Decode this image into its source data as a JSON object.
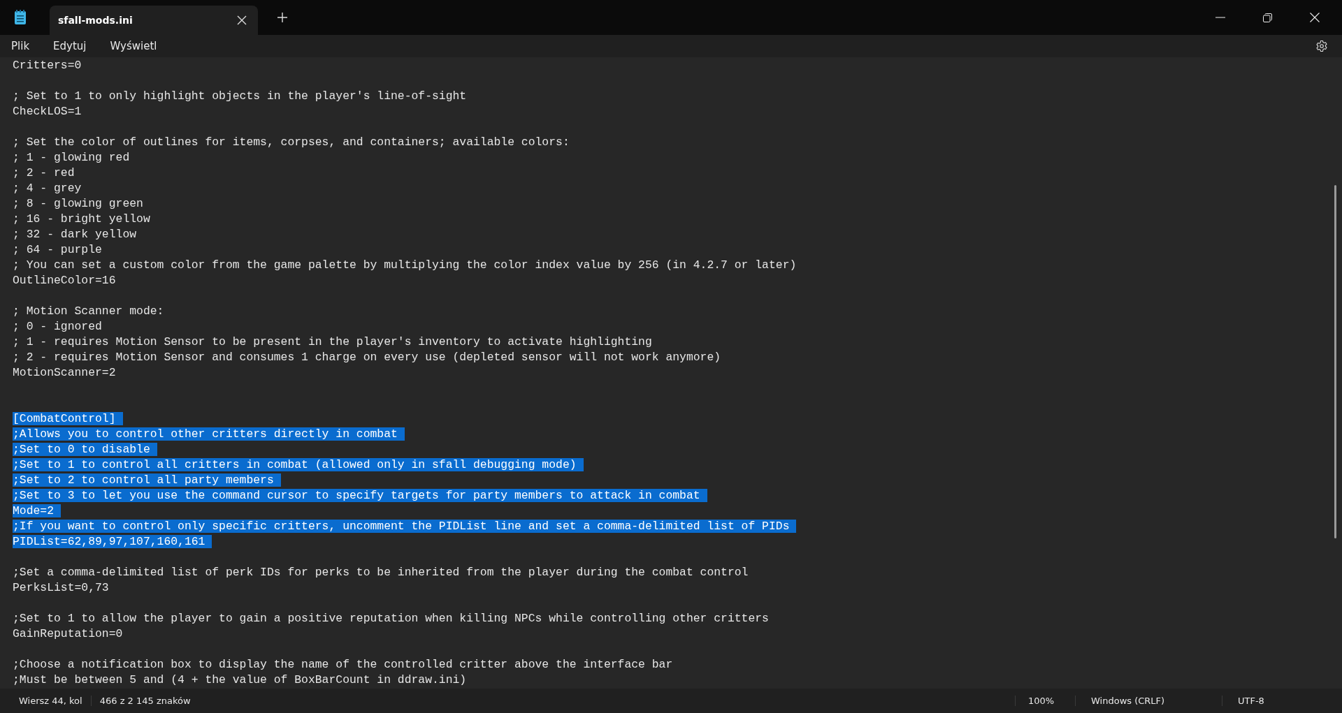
{
  "tab": {
    "title": "sfall-mods.ini",
    "selected": true
  },
  "menu": [
    "Plik",
    "Edytuj",
    "Wyświetl"
  ],
  "lines": [
    {
      "kind": "text",
      "text": "Critters=0",
      "selected": false
    },
    {
      "kind": "blank"
    },
    {
      "kind": "text",
      "text": "; Set to 1 to only highlight objects in the player's line-of-sight",
      "selected": false
    },
    {
      "kind": "text",
      "text": "CheckLOS=1",
      "selected": false
    },
    {
      "kind": "blank"
    },
    {
      "kind": "text",
      "text": "; Set the color of outlines for items, corpses, and containers; available colors:",
      "selected": false
    },
    {
      "kind": "text",
      "text": "; 1 - glowing red",
      "selected": false
    },
    {
      "kind": "text",
      "text": "; 2 - red",
      "selected": false
    },
    {
      "kind": "text",
      "text": "; 4 - grey",
      "selected": false
    },
    {
      "kind": "text",
      "text": "; 8 - glowing green",
      "selected": false
    },
    {
      "kind": "text",
      "text": "; 16 - bright yellow",
      "selected": false
    },
    {
      "kind": "text",
      "text": "; 32 - dark yellow",
      "selected": false
    },
    {
      "kind": "text",
      "text": "; 64 - purple",
      "selected": false
    },
    {
      "kind": "text",
      "text": "; You can set a custom color from the game palette by multiplying the color index value by 256 (in 4.2.7 or later)",
      "selected": false
    },
    {
      "kind": "text",
      "text": "OutlineColor=16",
      "selected": false
    },
    {
      "kind": "blank"
    },
    {
      "kind": "text",
      "text": "; Motion Scanner mode:",
      "selected": false
    },
    {
      "kind": "text",
      "text": "; 0 - ignored",
      "selected": false
    },
    {
      "kind": "text",
      "text": "; 1 - requires Motion Sensor to be present in the player's inventory to activate highlighting",
      "selected": false
    },
    {
      "kind": "text",
      "text": "; 2 - requires Motion Sensor and consumes 1 charge on every use (depleted sensor will not work anymore)",
      "selected": false
    },
    {
      "kind": "text",
      "text": "MotionScanner=2",
      "selected": false
    },
    {
      "kind": "blank"
    },
    {
      "kind": "blank"
    },
    {
      "kind": "text",
      "text": "[CombatControl]",
      "selected": true
    },
    {
      "kind": "text",
      "text": ";Allows you to control other critters directly in combat",
      "selected": true
    },
    {
      "kind": "text",
      "text": ";Set to 0 to disable",
      "selected": true
    },
    {
      "kind": "text",
      "text": ";Set to 1 to control all critters in combat (allowed only in sfall debugging mode)",
      "selected": true
    },
    {
      "kind": "text",
      "text": ";Set to 2 to control all party members",
      "selected": true
    },
    {
      "kind": "text",
      "text": ";Set to 3 to let you use the command cursor to specify targets for party members to attack in combat",
      "selected": true
    },
    {
      "kind": "text",
      "text": "Mode=2",
      "selected": true
    },
    {
      "kind": "text",
      "text": ";If you want to control only specific critters, uncomment the PIDList line and set a comma-delimited list of PIDs",
      "selected": true
    },
    {
      "kind": "text",
      "text": "PIDList=62,89,97,107,160,161",
      "selected": true
    },
    {
      "kind": "blank"
    },
    {
      "kind": "text",
      "text": ";Set a comma-delimited list of perk IDs for perks to be inherited from the player during the combat control",
      "selected": false
    },
    {
      "kind": "text",
      "text": "PerksList=0,73",
      "selected": false
    },
    {
      "kind": "blank"
    },
    {
      "kind": "text",
      "text": ";Set to 1 to allow the player to gain a positive reputation when killing NPCs while controlling other critters",
      "selected": false
    },
    {
      "kind": "text",
      "text": "GainReputation=0",
      "selected": false
    },
    {
      "kind": "blank"
    },
    {
      "kind": "text",
      "text": ";Choose a notification box to display the name of the controlled critter above the interface bar",
      "selected": false
    },
    {
      "kind": "text",
      "text": ";Must be between 5 and (4 + the value of BoxBarCount in ddraw.ini)",
      "selected": false
    }
  ],
  "status_bar": {
    "position": "Wiersz 44, kol",
    "count": "466 z 2 145 znaków",
    "zoom": "100%",
    "line_ending": "Windows (CRLF)",
    "encoding": "UTF-8"
  }
}
